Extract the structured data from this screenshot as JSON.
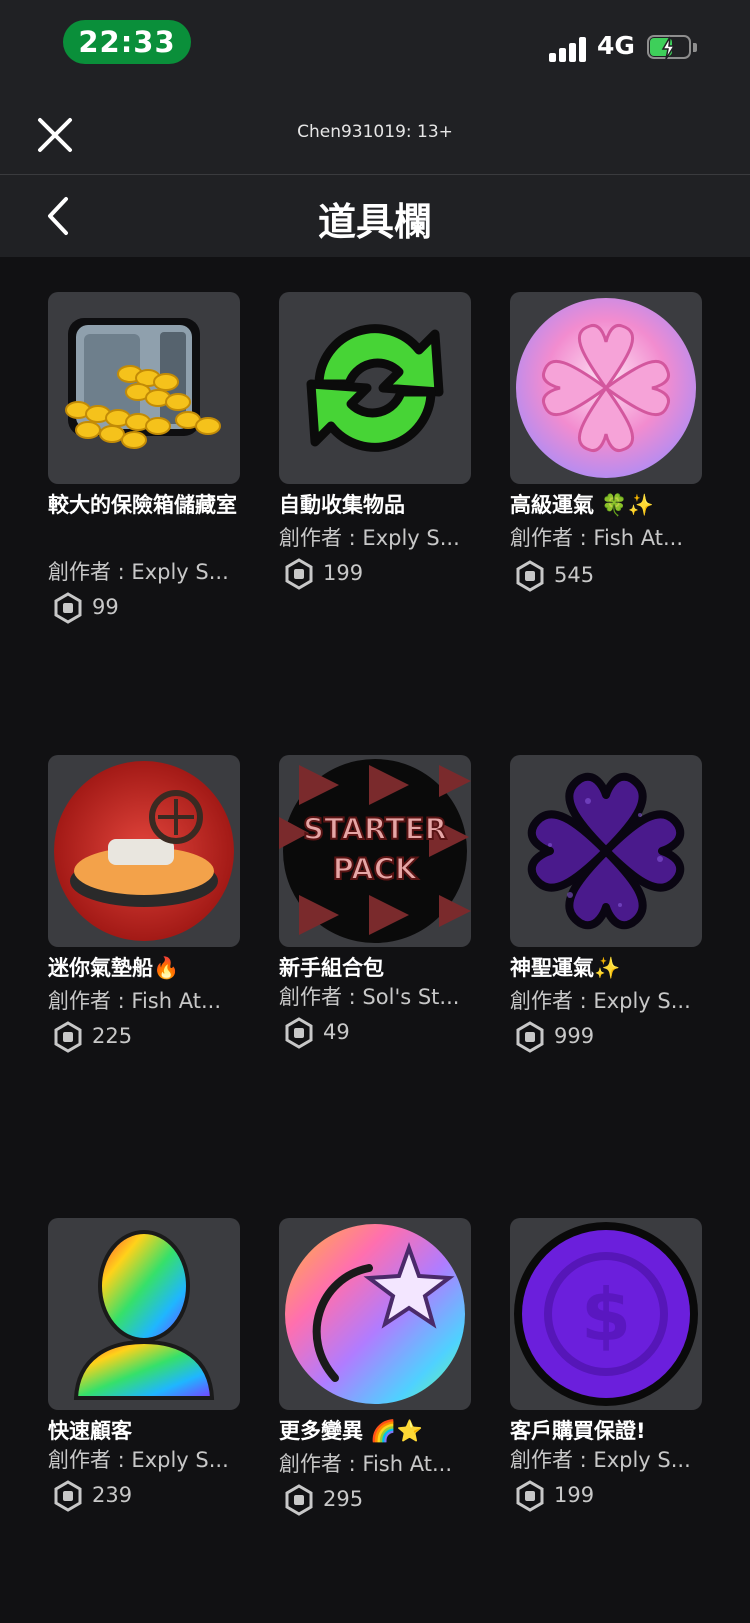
{
  "status_bar": {
    "time": "22:33",
    "network": "4G"
  },
  "top_bar": {
    "account_label": "Chen931019: 13+"
  },
  "header": {
    "title": "道具欄"
  },
  "items": [
    {
      "name": "較大的保險箱儲藏室",
      "creator": "創作者 : Exply S...",
      "price": "99",
      "icon": "safe-with-gold-coins-icon"
    },
    {
      "name": "自動收集物品",
      "creator": "創作者 : Exply S...",
      "price": "199",
      "icon": "green-refresh-arrows-icon"
    },
    {
      "name": "高級運氣 🍀✨",
      "creator": "創作者 : Fish At...",
      "price": "545",
      "icon": "pink-clover-orb-icon"
    },
    {
      "name": "迷你氣墊船🔥",
      "creator": "創作者 : Fish At...",
      "price": "225",
      "icon": "hovercraft-icon"
    },
    {
      "name": "新手組合包",
      "creator": "創作者 : Sol's St...",
      "price": "49",
      "icon": "starter-pack-badge-icon"
    },
    {
      "name": "神聖運氣✨",
      "creator": "創作者 : Exply S...",
      "price": "999",
      "icon": "purple-clover-icon"
    },
    {
      "name": "快速顧客",
      "creator": "創作者 : Exply S...",
      "price": "239",
      "icon": "rainbow-customer-icon"
    },
    {
      "name": "更多變異 🌈⭐",
      "creator": "創作者 : Fish At...",
      "price": "295",
      "icon": "rainbow-shooting-star-icon"
    },
    {
      "name": "客戶購買保證!",
      "creator": "創作者 : Exply S...",
      "price": "199",
      "icon": "purple-dollar-coin-icon"
    }
  ],
  "colors": {
    "background": "#111113",
    "bar": "#202124",
    "thumb": "#3b3c40",
    "time_pill": "#0a8f3a"
  }
}
